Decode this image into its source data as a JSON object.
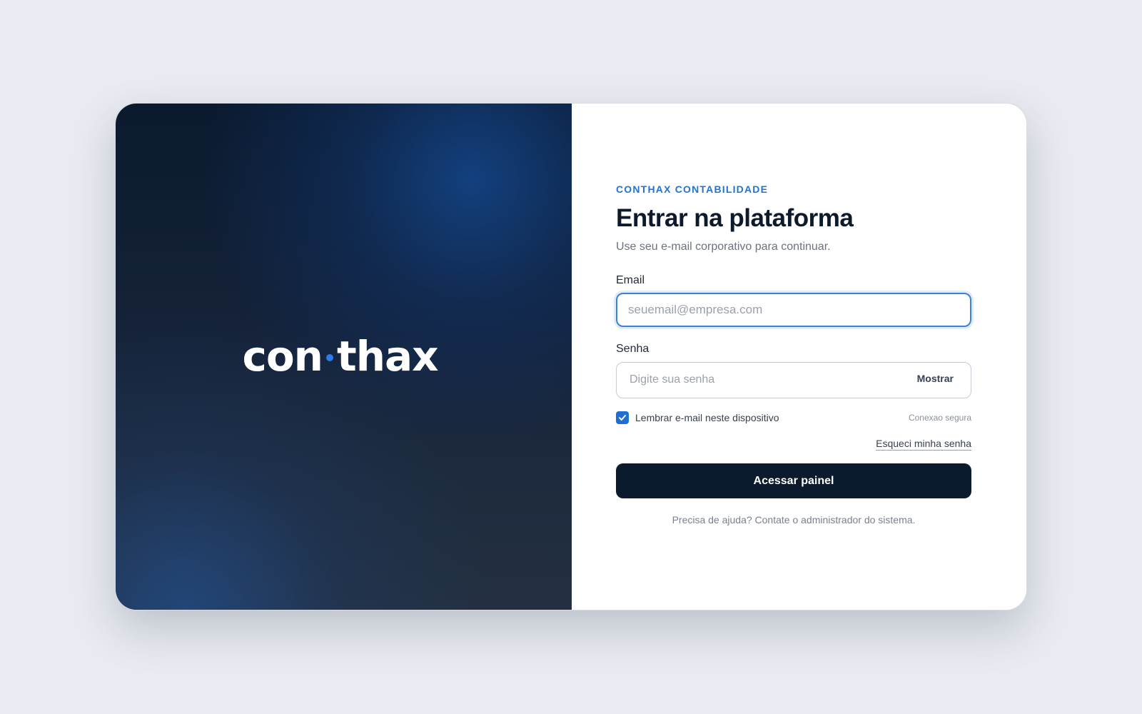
{
  "brand": {
    "logo_left": "con",
    "logo_right": "thax",
    "accent_color": "#2f7be8"
  },
  "form": {
    "eyebrow": "CONTHAX CONTABILIDADE",
    "title": "Entrar na plataforma",
    "subtitle": "Use seu e-mail corporativo para continuar.",
    "email": {
      "label": "Email",
      "placeholder": "seuemail@empresa.com",
      "value": ""
    },
    "password": {
      "label": "Senha",
      "placeholder": "Digite sua senha",
      "value": "",
      "toggle_label": "Mostrar"
    },
    "remember": {
      "label": "Lembrar e-mail neste dispositivo",
      "checked": true,
      "icon": "check-icon"
    },
    "secure_label": "Conexao segura",
    "forgot_link": "Esqueci minha senha",
    "submit_label": "Acessar painel",
    "help_text": "Precisa de ajuda? Contate o administrador do sistema."
  },
  "colors": {
    "primary": "#1e6fd4",
    "button_dark": "#0b1a2c",
    "background": "#e8ebf1"
  }
}
